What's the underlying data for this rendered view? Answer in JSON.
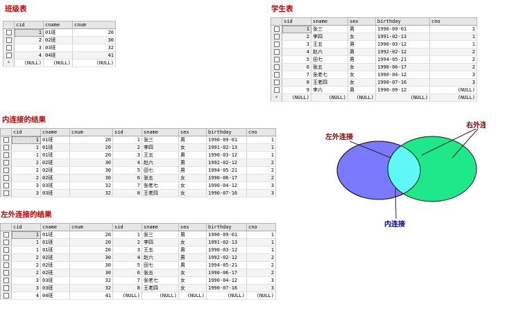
{
  "titles": {
    "class_table": "班级表",
    "student_table": "学生表",
    "inner_join": "内连接的结果",
    "left_join": "左外连接的结果"
  },
  "class_table": {
    "columns": [
      "cid",
      "cname",
      "cnum"
    ],
    "rows": [
      [
        "1",
        "01班",
        "20"
      ],
      [
        "2",
        "02班",
        "30"
      ],
      [
        "3",
        "03班",
        "32"
      ],
      [
        "4",
        "04班",
        "41"
      ],
      [
        "(NULL)",
        "(NULL)",
        "(NULL)"
      ]
    ]
  },
  "student_table": {
    "columns": [
      "sid",
      "sname",
      "sex",
      "birthday",
      "cno"
    ],
    "rows": [
      [
        "1",
        "张三",
        "男",
        "1990-09-01",
        "1"
      ],
      [
        "2",
        "李四",
        "女",
        "1991-02-13",
        "1"
      ],
      [
        "3",
        "王五",
        "男",
        "1990-03-12",
        "1"
      ],
      [
        "4",
        "赵六",
        "男",
        "1992-02-12",
        "2"
      ],
      [
        "5",
        "田七",
        "男",
        "1994-05-21",
        "2"
      ],
      [
        "6",
        "张五",
        "女",
        "1990-06-17",
        "2"
      ],
      [
        "7",
        "张老七",
        "女",
        "1990-04-12",
        "3"
      ],
      [
        "8",
        "王老四",
        "女",
        "1990-07-16",
        "3"
      ],
      [
        "9",
        "李六",
        "男",
        "1990-09-12",
        "(NULL)"
      ],
      [
        "(NULL)",
        "(NULL)",
        "(NULL)",
        "(NULL)",
        "(NULL)"
      ]
    ]
  },
  "inner_join_table": {
    "columns": [
      "cid",
      "cname",
      "cnum",
      "sid",
      "sname",
      "sex",
      "birthday",
      "cno"
    ],
    "rows": [
      [
        "1",
        "01班",
        "20",
        "1",
        "张三",
        "男",
        "1990-09-01",
        "1"
      ],
      [
        "1",
        "01班",
        "20",
        "2",
        "李四",
        "女",
        "1991-02-13",
        "1"
      ],
      [
        "1",
        "01班",
        "20",
        "3",
        "王五",
        "男",
        "1990-03-12",
        "1"
      ],
      [
        "2",
        "02班",
        "30",
        "4",
        "赵六",
        "男",
        "1992-02-12",
        "2"
      ],
      [
        "2",
        "02班",
        "30",
        "5",
        "田七",
        "男",
        "1994-05-21",
        "2"
      ],
      [
        "2",
        "02班",
        "30",
        "6",
        "张五",
        "女",
        "1990-06-17",
        "2"
      ],
      [
        "3",
        "03班",
        "32",
        "7",
        "张老七",
        "女",
        "1990-04-12",
        "3"
      ],
      [
        "3",
        "03班",
        "32",
        "8",
        "王老四",
        "女",
        "1990-07-16",
        "3"
      ]
    ]
  },
  "left_join_table": {
    "columns": [
      "cid",
      "cname",
      "cnum",
      "sid",
      "sname",
      "sex",
      "birthday",
      "cno"
    ],
    "rows": [
      [
        "1",
        "01班",
        "20",
        "1",
        "张三",
        "男",
        "1990-09-01",
        "1"
      ],
      [
        "1",
        "01班",
        "20",
        "2",
        "李四",
        "女",
        "1991-02-13",
        "1"
      ],
      [
        "1",
        "01班",
        "20",
        "3",
        "王五",
        "男",
        "1990-03-12",
        "1"
      ],
      [
        "2",
        "02班",
        "30",
        "4",
        "赵六",
        "男",
        "1992-02-12",
        "2"
      ],
      [
        "2",
        "02班",
        "30",
        "5",
        "田七",
        "男",
        "1994-05-21",
        "2"
      ],
      [
        "2",
        "02班",
        "30",
        "6",
        "张五",
        "女",
        "1990-06-17",
        "2"
      ],
      [
        "3",
        "03班",
        "32",
        "7",
        "张老七",
        "女",
        "1990-04-12",
        "3"
      ],
      [
        "3",
        "03班",
        "32",
        "8",
        "王老四",
        "女",
        "1990-07-16",
        "3"
      ],
      [
        "4",
        "04班",
        "41",
        "(NULL)",
        "(NULL)",
        "(NULL)",
        "(NULL)",
        "(NULL)"
      ]
    ]
  },
  "venn": {
    "left_label": "左外连接",
    "right_label": "右外连接",
    "inner_label": "内连接",
    "colors": {
      "left": "#7a7aff",
      "right": "#1ee88a",
      "inner": "#60f7f7",
      "left_label": "#8b0000",
      "right_label": "#8b0000",
      "inner_label": "#00008b"
    }
  }
}
